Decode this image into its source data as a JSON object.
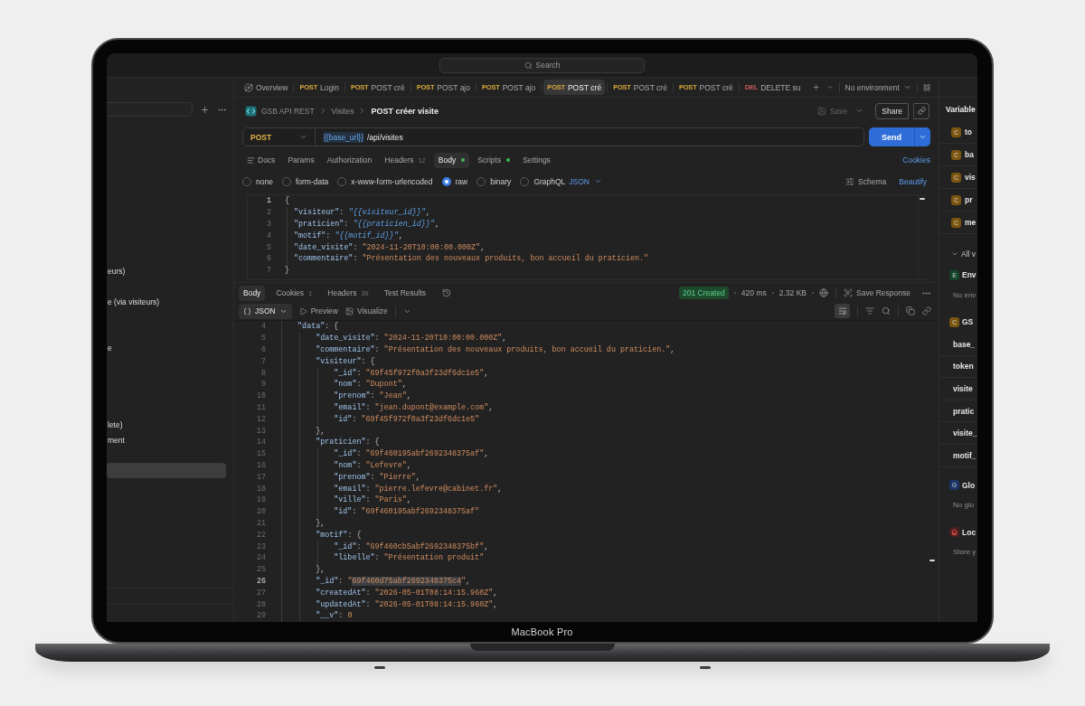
{
  "titlebar": {
    "search": {
      "placeholder": "Search"
    }
  },
  "sidebar": {
    "rows": [
      {
        "label": "eurs)",
        "selected": false
      },
      {
        "selected": false
      },
      {
        "label": "e (via visiteurs)",
        "selected": false
      },
      {
        "selected": false
      },
      {
        "selected": false
      },
      {
        "label": "e",
        "selected": false
      },
      {
        "selected": false
      },
      {
        "selected": false
      },
      {
        "selected": false
      },
      {
        "selected": false
      },
      {
        "label": "lete)",
        "selected": false
      },
      {
        "label": "ment",
        "selected": false
      },
      {
        "selected": false
      },
      {
        "selected": true
      }
    ]
  },
  "tabs": [
    {
      "kind": "overview",
      "label": "Overview",
      "selected": false
    },
    {
      "kind": "request",
      "method": "POST",
      "color": "#d9a83c",
      "label": "Login",
      "selected": false
    },
    {
      "kind": "request",
      "method": "POST",
      "color": "#d9a83c",
      "label": "POST cré",
      "selected": false
    },
    {
      "kind": "request",
      "method": "POST",
      "color": "#d9a83c",
      "label": "POST ajo",
      "selected": false
    },
    {
      "kind": "request",
      "method": "POST",
      "color": "#d9a83c",
      "label": "POST ajo",
      "selected": false
    },
    {
      "kind": "request",
      "method": "POST",
      "color": "#d9a83c",
      "label": "POST cré",
      "selected": true
    },
    {
      "kind": "request",
      "method": "POST",
      "color": "#d9a83c",
      "label": "POST cré",
      "selected": false
    },
    {
      "kind": "request",
      "method": "POST",
      "color": "#d9a83c",
      "label": "POST cré",
      "selected": false
    },
    {
      "kind": "request",
      "method": "DEL",
      "color": "#c75c5c",
      "label": "DELETE su",
      "selected": false
    }
  ],
  "environment": {
    "label": "No environment"
  },
  "request": {
    "breadcrumb": [
      "GSB API REST",
      "Visites"
    ],
    "title": "POST créer visite",
    "save": {
      "label": "Save",
      "disabled": true
    },
    "share": {
      "label": "Share"
    },
    "method": "POST",
    "url": [
      {
        "kind": "variable",
        "text": "{{base_url}}"
      },
      {
        "kind": "path",
        "text": "/api/visites"
      }
    ],
    "send": {
      "label": "Send"
    },
    "tabs": [
      {
        "kind": "docs",
        "label": "Docs",
        "selected": false,
        "indicator": false
      },
      {
        "kind": "plain",
        "label": "Params",
        "selected": false,
        "indicator": false
      },
      {
        "kind": "plain",
        "label": "Authorization",
        "selected": false,
        "indicator": false
      },
      {
        "kind": "plain",
        "label": "Headers",
        "count": "12",
        "selected": false,
        "indicator": false
      },
      {
        "kind": "plain",
        "label": "Body",
        "selected": true,
        "indicator": true
      },
      {
        "kind": "plain",
        "label": "Scripts",
        "selected": false,
        "indicator": true
      },
      {
        "kind": "plain",
        "label": "Settings",
        "selected": false,
        "indicator": false
      }
    ],
    "cookies": "Cookies",
    "body_types": [
      {
        "label": "none",
        "selected": false
      },
      {
        "label": "form-data",
        "selected": false
      },
      {
        "label": "x-www-form-urlencoded",
        "selected": false
      },
      {
        "label": "raw",
        "selected": true
      },
      {
        "label": "binary",
        "selected": false
      },
      {
        "label": "GraphQL",
        "selected": false
      }
    ],
    "format": "JSON",
    "schema": "Schema",
    "beautify": "Beautify",
    "body": [
      {
        "number": "1",
        "active": true,
        "tokens": [
          {
            "kind": "punct",
            "text": "{"
          }
        ],
        "children": [
          {
            "number": "2",
            "active": false,
            "tokens": [
              {
                "kind": "key",
                "text": "\"visiteur\""
              },
              {
                "kind": "punct",
                "text": ": "
              },
              {
                "kind": "variable",
                "text": "\"{{visiteur_id}}\""
              },
              {
                "kind": "punct",
                "text": ","
              }
            ]
          },
          {
            "number": "3",
            "active": false,
            "tokens": [
              {
                "kind": "key",
                "text": "\"praticien\""
              },
              {
                "kind": "punct",
                "text": ": "
              },
              {
                "kind": "variable",
                "text": "\"{{praticien_id}}\""
              },
              {
                "kind": "punct",
                "text": ","
              }
            ]
          },
          {
            "number": "4",
            "active": false,
            "tokens": [
              {
                "kind": "key",
                "text": "\"motif\""
              },
              {
                "kind": "punct",
                "text": ": "
              },
              {
                "kind": "variable",
                "text": "\"{{motif_id}}\""
              },
              {
                "kind": "punct",
                "text": ","
              }
            ]
          },
          {
            "number": "5",
            "active": false,
            "tokens": [
              {
                "kind": "key",
                "text": "\"date_visite\""
              },
              {
                "kind": "punct",
                "text": ": "
              },
              {
                "kind": "string",
                "text": "\"2024-11-20T10:00:00.000Z\""
              },
              {
                "kind": "punct",
                "text": ","
              }
            ]
          },
          {
            "number": "6",
            "active": false,
            "tokens": [
              {
                "kind": "key",
                "text": "\"commentaire\""
              },
              {
                "kind": "punct",
                "text": ": "
              },
              {
                "kind": "string",
                "text": "\"Présentation des nouveaux produits, bon accueil du praticien.\""
              }
            ]
          }
        ]
      },
      {
        "number": "7",
        "active": false,
        "tokens": [
          {
            "kind": "punct",
            "text": "}"
          }
        ]
      }
    ]
  },
  "response": {
    "tabs": [
      {
        "label": "Body",
        "selected": true
      },
      {
        "label": "Cookies",
        "count": "1",
        "selected": false
      },
      {
        "label": "Headers",
        "count": "39",
        "selected": false
      },
      {
        "label": "Test Results",
        "selected": false
      }
    ],
    "status": "201 Created",
    "time": "420 ms",
    "size": "2.32 KB",
    "save": "Save Response",
    "view": {
      "format": "JSON",
      "preview": "Preview",
      "visualize": "Visualize"
    },
    "word_wrap": true,
    "body": [
      {
        "number": "4",
        "active": false,
        "tokens": [
          {
            "kind": "key",
            "text": "\"data\""
          },
          {
            "kind": "punct",
            "text": ": {"
          }
        ],
        "children": [
          {
            "number": "5",
            "active": false,
            "tokens": [
              {
                "kind": "key",
                "text": "\"date_visite\""
              },
              {
                "kind": "punct",
                "text": ": "
              },
              {
                "kind": "string",
                "text": "\"2024-11-20T10:00:00.000Z\""
              },
              {
                "kind": "punct",
                "text": ","
              }
            ]
          },
          {
            "number": "6",
            "active": false,
            "tokens": [
              {
                "kind": "key",
                "text": "\"commentaire\""
              },
              {
                "kind": "punct",
                "text": ": "
              },
              {
                "kind": "string",
                "text": "\"Présentation des nouveaux produits, bon accueil du praticien.\""
              },
              {
                "kind": "punct",
                "text": ","
              }
            ]
          },
          {
            "number": "7",
            "active": false,
            "tokens": [
              {
                "kind": "key",
                "text": "\"visiteur\""
              },
              {
                "kind": "punct",
                "text": ": {"
              }
            ],
            "children": [
              {
                "number": "8",
                "active": false,
                "tokens": [
                  {
                    "kind": "key",
                    "text": "\"_id\""
                  },
                  {
                    "kind": "punct",
                    "text": ": "
                  },
                  {
                    "kind": "string",
                    "text": "\"69f45f972f0a3f23df6dc1e5\""
                  },
                  {
                    "kind": "punct",
                    "text": ","
                  }
                ]
              },
              {
                "number": "9",
                "active": false,
                "tokens": [
                  {
                    "kind": "key",
                    "text": "\"nom\""
                  },
                  {
                    "kind": "punct",
                    "text": ": "
                  },
                  {
                    "kind": "string",
                    "text": "\"Dupont\""
                  },
                  {
                    "kind": "punct",
                    "text": ","
                  }
                ]
              },
              {
                "number": "10",
                "active": false,
                "tokens": [
                  {
                    "kind": "key",
                    "text": "\"prenom\""
                  },
                  {
                    "kind": "punct",
                    "text": ": "
                  },
                  {
                    "kind": "string",
                    "text": "\"Jean\""
                  },
                  {
                    "kind": "punct",
                    "text": ","
                  }
                ]
              },
              {
                "number": "11",
                "active": false,
                "tokens": [
                  {
                    "kind": "key",
                    "text": "\"email\""
                  },
                  {
                    "kind": "punct",
                    "text": ": "
                  },
                  {
                    "kind": "string",
                    "text": "\"jean.dupont@example.com\""
                  },
                  {
                    "kind": "punct",
                    "text": ","
                  }
                ]
              },
              {
                "number": "12",
                "active": false,
                "tokens": [
                  {
                    "kind": "key",
                    "text": "\"id\""
                  },
                  {
                    "kind": "punct",
                    "text": ": "
                  },
                  {
                    "kind": "string",
                    "text": "\"69f45f972f0a3f23df6dc1e5\""
                  }
                ]
              }
            ]
          },
          {
            "number": "13",
            "active": false,
            "tokens": [
              {
                "kind": "punct",
                "text": "},"
              }
            ]
          },
          {
            "number": "14",
            "active": false,
            "tokens": [
              {
                "kind": "key",
                "text": "\"praticien\""
              },
              {
                "kind": "punct",
                "text": ": {"
              }
            ],
            "children": [
              {
                "number": "15",
                "active": false,
                "tokens": [
                  {
                    "kind": "key",
                    "text": "\"_id\""
                  },
                  {
                    "kind": "punct",
                    "text": ": "
                  },
                  {
                    "kind": "string",
                    "text": "\"69f460195abf2692348375af\""
                  },
                  {
                    "kind": "punct",
                    "text": ","
                  }
                ]
              },
              {
                "number": "16",
                "active": false,
                "tokens": [
                  {
                    "kind": "key",
                    "text": "\"nom\""
                  },
                  {
                    "kind": "punct",
                    "text": ": "
                  },
                  {
                    "kind": "string",
                    "text": "\"Lefevre\""
                  },
                  {
                    "kind": "punct",
                    "text": ","
                  }
                ]
              },
              {
                "number": "17",
                "active": false,
                "tokens": [
                  {
                    "kind": "key",
                    "text": "\"prenom\""
                  },
                  {
                    "kind": "punct",
                    "text": ": "
                  },
                  {
                    "kind": "string",
                    "text": "\"Pierre\""
                  },
                  {
                    "kind": "punct",
                    "text": ","
                  }
                ]
              },
              {
                "number": "18",
                "active": false,
                "tokens": [
                  {
                    "kind": "key",
                    "text": "\"email\""
                  },
                  {
                    "kind": "punct",
                    "text": ": "
                  },
                  {
                    "kind": "string",
                    "text": "\"pierre.lefevre@cabinet.fr\""
                  },
                  {
                    "kind": "punct",
                    "text": ","
                  }
                ]
              },
              {
                "number": "19",
                "active": false,
                "tokens": [
                  {
                    "kind": "key",
                    "text": "\"ville\""
                  },
                  {
                    "kind": "punct",
                    "text": ": "
                  },
                  {
                    "kind": "string",
                    "text": "\"Paris\""
                  },
                  {
                    "kind": "punct",
                    "text": ","
                  }
                ]
              },
              {
                "number": "20",
                "active": false,
                "tokens": [
                  {
                    "kind": "key",
                    "text": "\"id\""
                  },
                  {
                    "kind": "punct",
                    "text": ": "
                  },
                  {
                    "kind": "string",
                    "text": "\"69f460195abf2692348375af\""
                  }
                ]
              }
            ]
          },
          {
            "number": "21",
            "active": false,
            "tokens": [
              {
                "kind": "punct",
                "text": "},"
              }
            ]
          },
          {
            "number": "22",
            "active": false,
            "tokens": [
              {
                "kind": "key",
                "text": "\"motif\""
              },
              {
                "kind": "punct",
                "text": ": {"
              }
            ],
            "children": [
              {
                "number": "23",
                "active": false,
                "tokens": [
                  {
                    "kind": "key",
                    "text": "\"_id\""
                  },
                  {
                    "kind": "punct",
                    "text": ": "
                  },
                  {
                    "kind": "string",
                    "text": "\"69f460cb5abf2692348375bf\""
                  },
                  {
                    "kind": "punct",
                    "text": ","
                  }
                ]
              },
              {
                "number": "24",
                "active": false,
                "tokens": [
                  {
                    "kind": "key",
                    "text": "\"libelle\""
                  },
                  {
                    "kind": "punct",
                    "text": ": "
                  },
                  {
                    "kind": "string",
                    "text": "\"Présentation produit\""
                  }
                ]
              }
            ]
          },
          {
            "number": "25",
            "active": false,
            "tokens": [
              {
                "kind": "punct",
                "text": "},"
              }
            ]
          },
          {
            "number": "26",
            "active": true,
            "tokens": [
              {
                "kind": "key",
                "text": "\"_id\""
              },
              {
                "kind": "punct",
                "text": ": "
              },
              {
                "kind": "string",
                "text": "\""
              },
              {
                "kind": "selection",
                "text": "69f460d75abf2692348375c4"
              },
              {
                "kind": "string",
                "text": "\""
              },
              {
                "kind": "punct",
                "text": ","
              }
            ]
          },
          {
            "number": "27",
            "active": false,
            "tokens": [
              {
                "kind": "key",
                "text": "\"createdAt\""
              },
              {
                "kind": "punct",
                "text": ": "
              },
              {
                "kind": "string",
                "text": "\"2026-05-01T08:14:15.960Z\""
              },
              {
                "kind": "punct",
                "text": ","
              }
            ]
          },
          {
            "number": "28",
            "active": false,
            "tokens": [
              {
                "kind": "key",
                "text": "\"updatedAt\""
              },
              {
                "kind": "punct",
                "text": ": "
              },
              {
                "kind": "string",
                "text": "\"2026-05-01T08:14:15.960Z\""
              },
              {
                "kind": "punct",
                "text": ","
              }
            ]
          },
          {
            "number": "29",
            "active": false,
            "tokens": [
              {
                "kind": "key",
                "text": "\"__v\""
              },
              {
                "kind": "punct",
                "text": ": "
              },
              {
                "kind": "number",
                "text": "0"
              }
            ]
          }
        ]
      }
    ]
  },
  "variables": {
    "title": "Variable",
    "items": [
      {
        "badge": "C",
        "color": "#7a5510",
        "name": "to"
      },
      {
        "badge": "C",
        "color": "#7a5510",
        "name": "ba"
      },
      {
        "badge": "C",
        "color": "#7a5510",
        "name": "vis"
      },
      {
        "badge": "C",
        "color": "#7a5510",
        "name": "pr"
      },
      {
        "badge": "C",
        "color": "#7a5510",
        "name": "me"
      }
    ],
    "filter": "All v",
    "groups": [
      {
        "kind": "badge",
        "badge": "E",
        "color": "#15432a",
        "title": "Env",
        "note": "No env"
      },
      {
        "kind": "badge",
        "badge": "C",
        "color": "#7a5510",
        "title": "GS",
        "rows": [
          "base_",
          "token",
          "visite",
          "pratic",
          "visite_",
          "motif_"
        ]
      },
      {
        "kind": "badge",
        "badge": "G",
        "color": "#1b3566",
        "title": "Glo",
        "note": "No glo"
      },
      {
        "kind": "local",
        "title": "Loc",
        "note": "Store y"
      }
    ]
  },
  "device": {
    "label": "MacBook Pro"
  }
}
